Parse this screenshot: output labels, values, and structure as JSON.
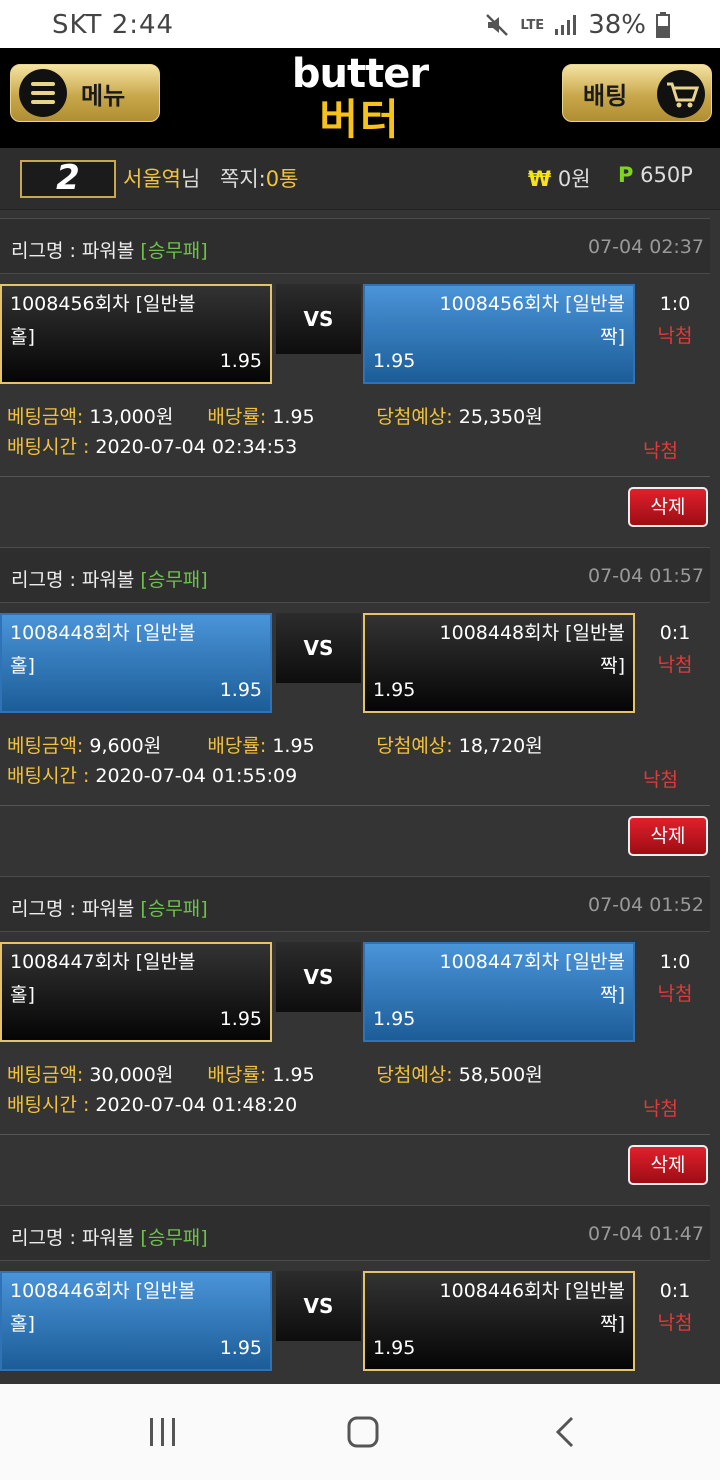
{
  "status_bar": {
    "carrier": "SKT",
    "time": "2:44",
    "network": "LTE",
    "battery": "38%"
  },
  "header": {
    "menu_label": "메뉴",
    "logo_en": "butter",
    "logo_ko": "버터",
    "bet_label": "배팅"
  },
  "user": {
    "level": "2",
    "name": "서울역",
    "suffix": "님",
    "note_label": "쪽지:",
    "note_count": "0통",
    "won_symbol": "₩",
    "won_value": "0원",
    "point_symbol": "P",
    "point_value": "650P"
  },
  "labels": {
    "league": "리그명 : 파워볼",
    "bet_amount": "베팅금액:",
    "odds": "배당률:",
    "expected": "당첨예상:",
    "bet_time": "배팅시간 :",
    "delete": "삭제",
    "vs": "VS"
  },
  "bets": [
    {
      "type": "[승무패]",
      "time": "07-04 02:37",
      "home_line1": "1008456회차 [일반볼",
      "home_line2": "홀]",
      "home_odds": "1.95",
      "away_line1": "1008456회차 [일반볼",
      "away_line2": "짝]",
      "away_odds": "1.95",
      "score": "1:0",
      "result": "낙첨",
      "amount": "13,000원",
      "rate": "1.95",
      "expected": "25,350원",
      "bet_time": "2020-07-04 02:34:53",
      "status": "낙첨",
      "selected": "home"
    },
    {
      "type": "[승무패]",
      "time": "07-04 01:57",
      "home_line1": "1008448회차 [일반볼",
      "home_line2": "홀]",
      "home_odds": "1.95",
      "away_line1": "1008448회차 [일반볼",
      "away_line2": "짝]",
      "away_odds": "1.95",
      "score": "0:1",
      "result": "낙첨",
      "amount": "9,600원",
      "rate": "1.95",
      "expected": "18,720원",
      "bet_time": "2020-07-04 01:55:09",
      "status": "낙첨",
      "selected": "away"
    },
    {
      "type": "[승무패]",
      "time": "07-04 01:52",
      "home_line1": "1008447회차 [일반볼",
      "home_line2": "홀]",
      "home_odds": "1.95",
      "away_line1": "1008447회차 [일반볼",
      "away_line2": "짝]",
      "away_odds": "1.95",
      "score": "1:0",
      "result": "낙첨",
      "amount": "30,000원",
      "rate": "1.95",
      "expected": "58,500원",
      "bet_time": "2020-07-04 01:48:20",
      "status": "낙첨",
      "selected": "home"
    },
    {
      "type": "[승무패]",
      "time": "07-04 01:47",
      "home_line1": "1008446회차 [일반볼",
      "home_line2": "홀]",
      "home_odds": "1.95",
      "away_line1": "1008446회차 [일반볼",
      "away_line2": "짝]",
      "away_odds": "1.95",
      "score": "0:1",
      "result": "낙첨",
      "selected": "away"
    }
  ],
  "colors": {
    "accent_gold": "#c9a84c",
    "logo_yellow": "#f7c31b",
    "loss_red": "#e03a3a",
    "type_green": "#6cc24a",
    "team_blue": "#2f73b6"
  },
  "icons": {
    "menu": "list-icon",
    "bet": "cart-icon",
    "nav_recent": "recent-apps-icon",
    "nav_home": "home-icon",
    "nav_back": "back-icon"
  }
}
